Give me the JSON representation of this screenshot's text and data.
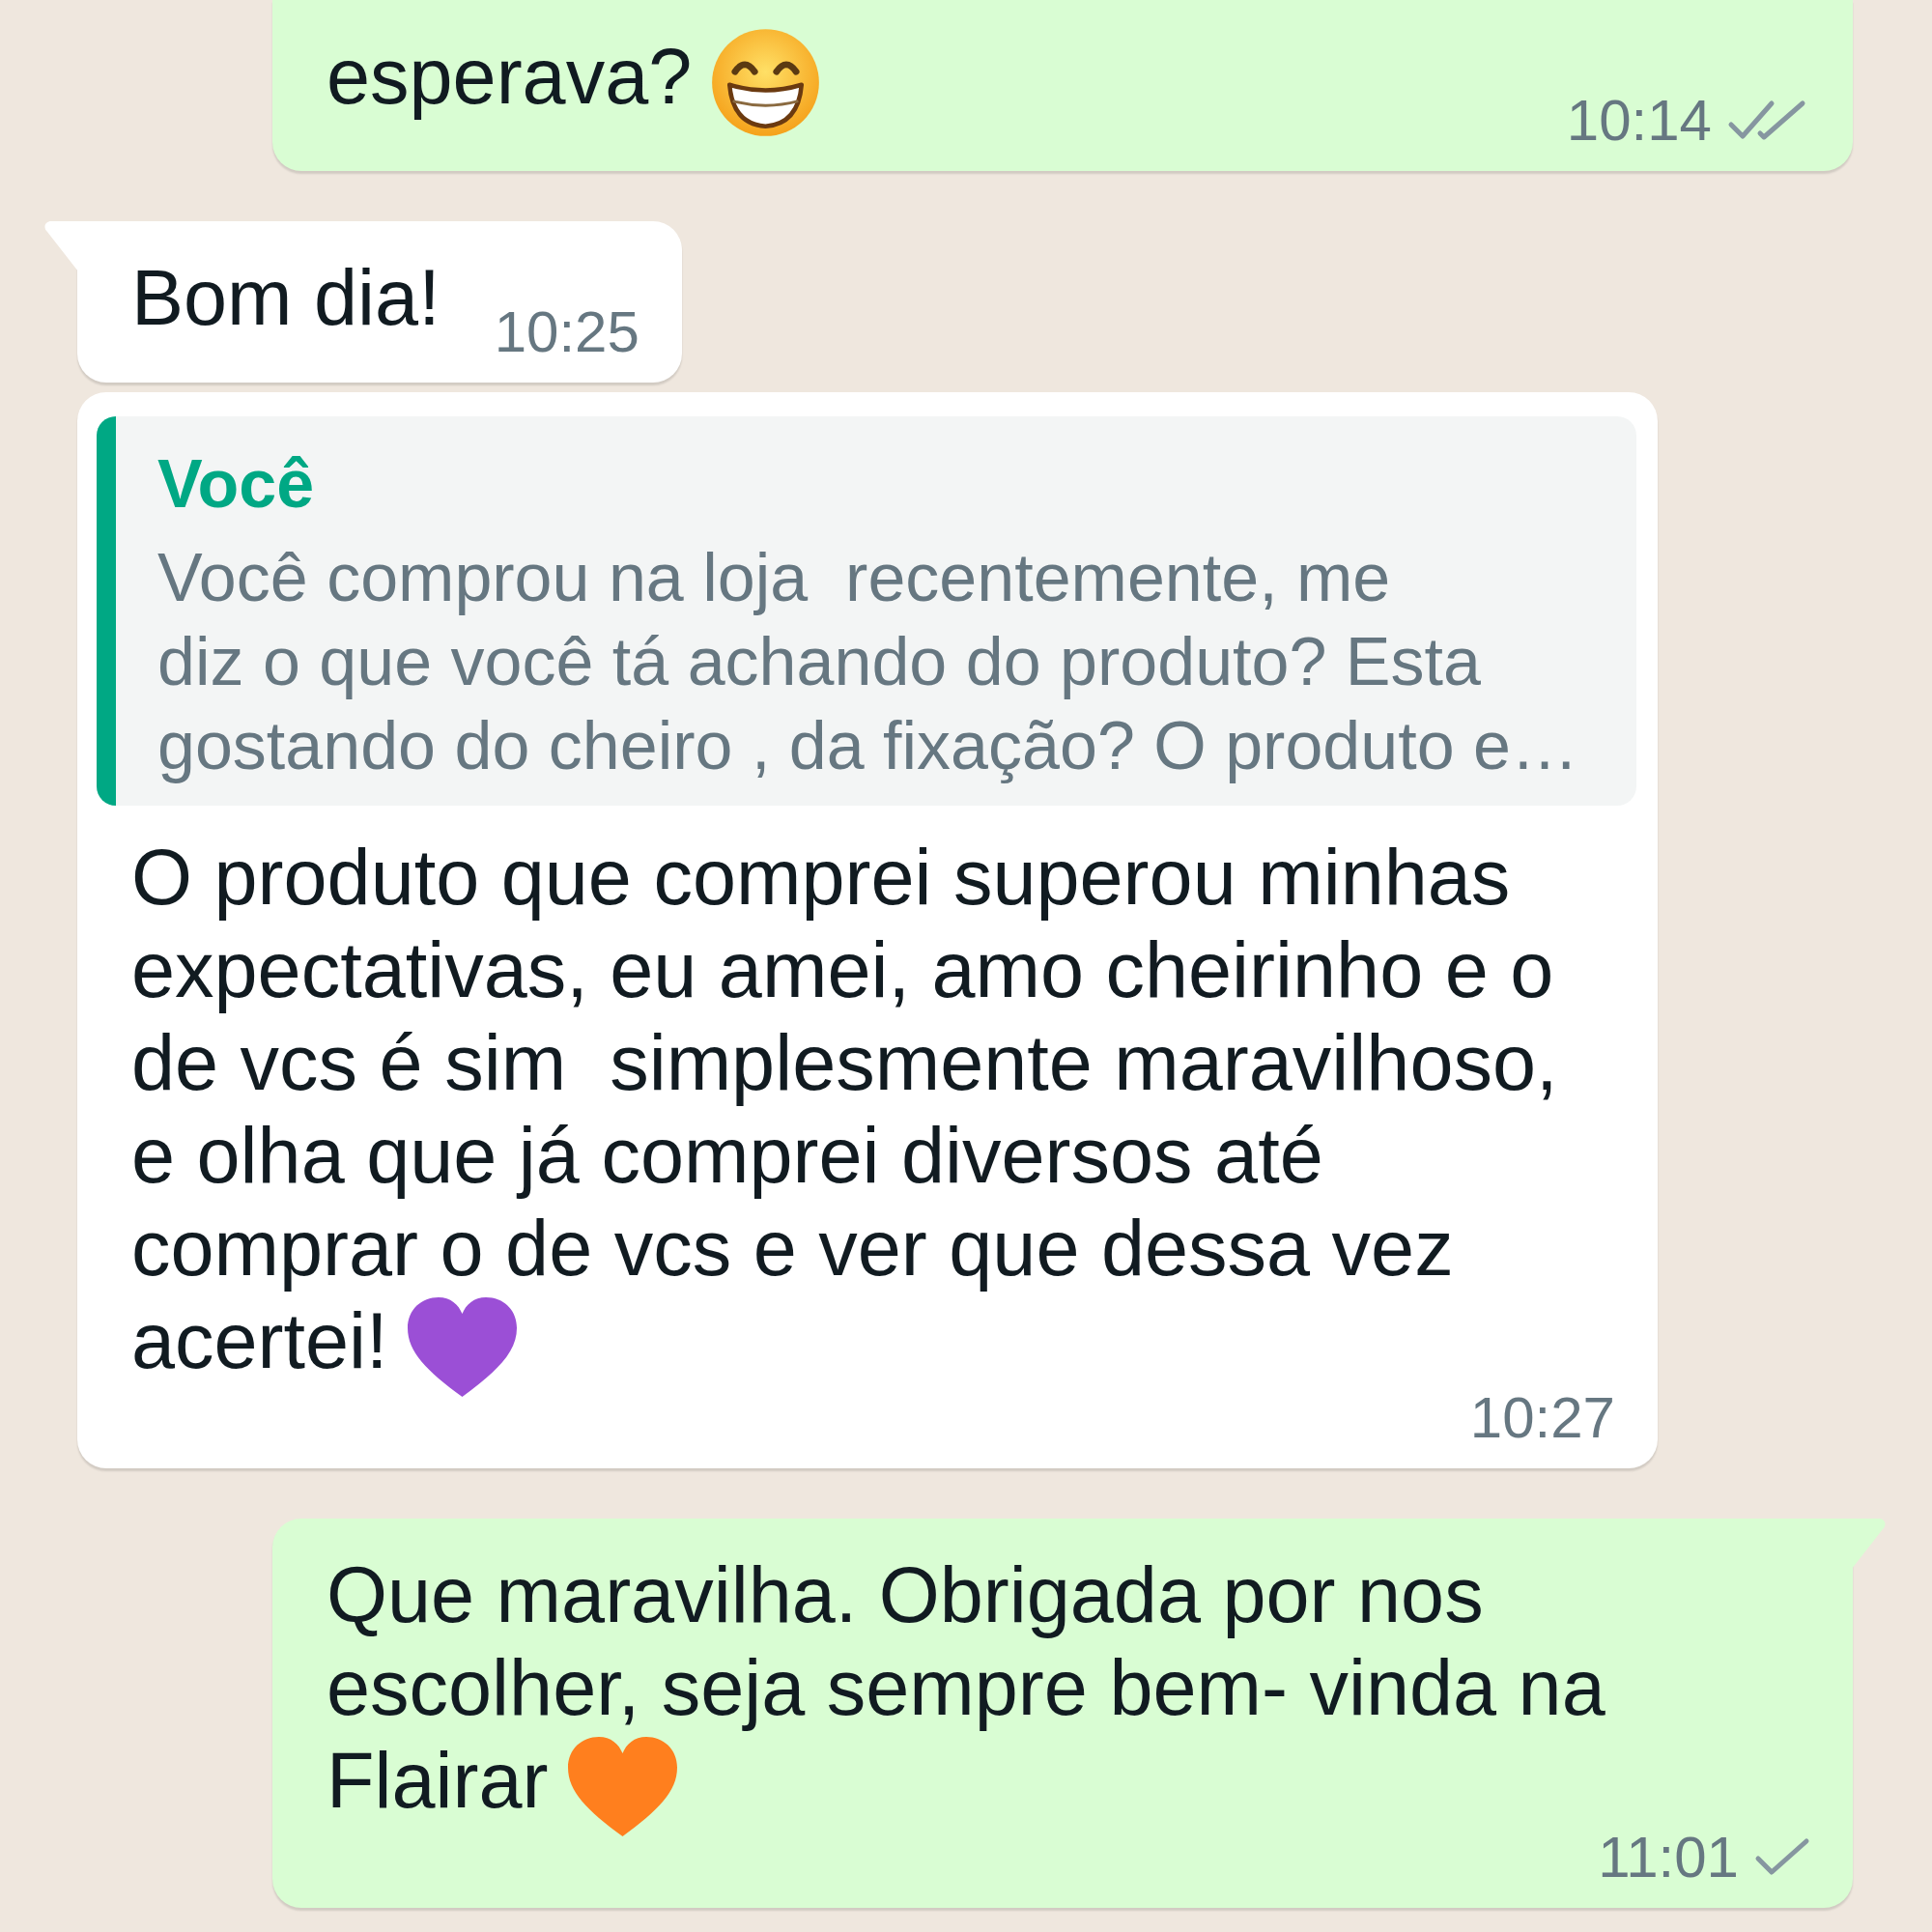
{
  "chat": {
    "messages": [
      {
        "kind": "outgoing",
        "tail": false,
        "text": "esperava?",
        "emoji": {
          "kind": "grinning-face"
        },
        "time": "10:14",
        "delivered": true,
        "read": false
      },
      {
        "kind": "incoming",
        "tail": true,
        "text": "Bom dia!",
        "time": "10:25"
      },
      {
        "kind": "incoming",
        "tail": false,
        "quote": {
          "author": "Você",
          "text": "Você comprou na loja  recentemente, me\ndiz o que você tá achando do produto? Esta\ngostando do cheiro , da fixação? O produto e…"
        },
        "text": "O produto que comprei superou minhas\nexpectativas, eu amei, amo cheirinho e o\nde vcs é sim  simplesmente maravilhoso,\ne olha que já comprei diversos até\ncomprar o de vcs e ver que dessa vez\nacertei!",
        "emoji": {
          "kind": "heart",
          "color": "#9b4fd6"
        },
        "time": "10:27"
      },
      {
        "kind": "outgoing",
        "tail": true,
        "text": "Que maravilha. Obrigada por nos\nescolher, seja sempre bem- vinda na\nFlairar",
        "emoji": {
          "kind": "heart",
          "color": "#ff7f1e"
        },
        "time": "11:01",
        "delivered": false,
        "read": false
      }
    ]
  }
}
